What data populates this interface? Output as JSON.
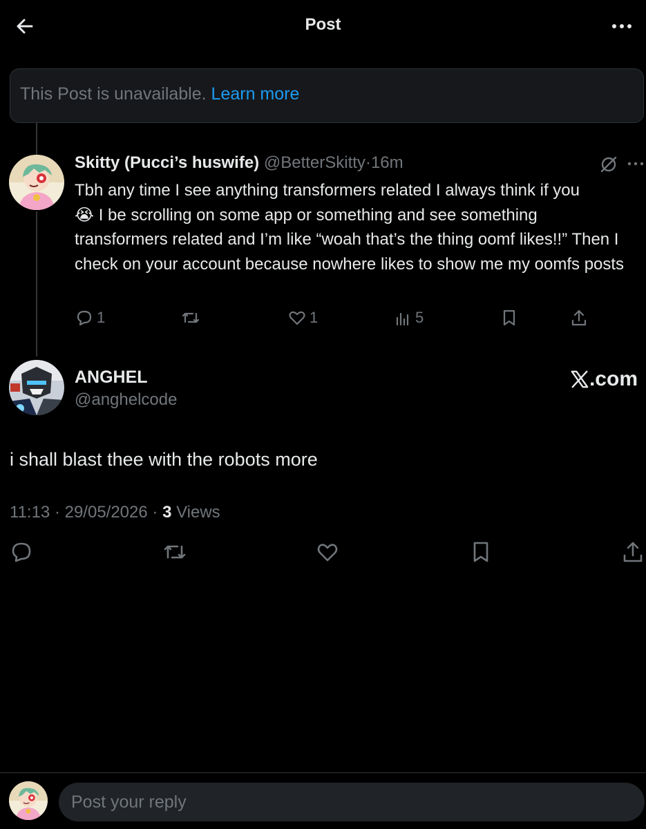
{
  "header": {
    "title": "Post"
  },
  "unavailable": {
    "text": "This Post is unavailable.",
    "link": "Learn more"
  },
  "reply": {
    "name": "Skitty (Pucci’s huswife)",
    "handle": "@BetterSkitty",
    "separator": "·",
    "time": "16m",
    "text_line1": "Tbh any time I see anything transformers related I always think if you",
    "emoji": "😭",
    "text_rest": " I be scrolling on some app or something and see something transformers related and I’m like “woah that’s the thing oomf likes!!” Then I check on your account because nowhere likes to show me my oomfs posts",
    "replies": "1",
    "likes": "1",
    "views": "5"
  },
  "post": {
    "name": "ANGHEL",
    "handle": "@anghelcode",
    "brand": ".com",
    "text": "i shall blast thee with the robots more",
    "time": "11:13",
    "date": "29/05/2026",
    "views_count": "3",
    "views_label": "Views"
  },
  "composer": {
    "placeholder": "Post your reply"
  },
  "icons": {
    "back": "arrow-left-icon",
    "more": "more-horizontal-icon",
    "mute": "muted-circle-icon",
    "reply": "reply-bubble-icon",
    "repost": "repost-icon",
    "like": "heart-icon",
    "views": "analytics-icon",
    "bookmark": "bookmark-icon",
    "share": "share-icon",
    "brand": "x-logo-icon"
  },
  "colors": {
    "background": "#000000",
    "text": "#e7e9ea",
    "muted": "#71767b",
    "link": "#1d9bf0"
  }
}
